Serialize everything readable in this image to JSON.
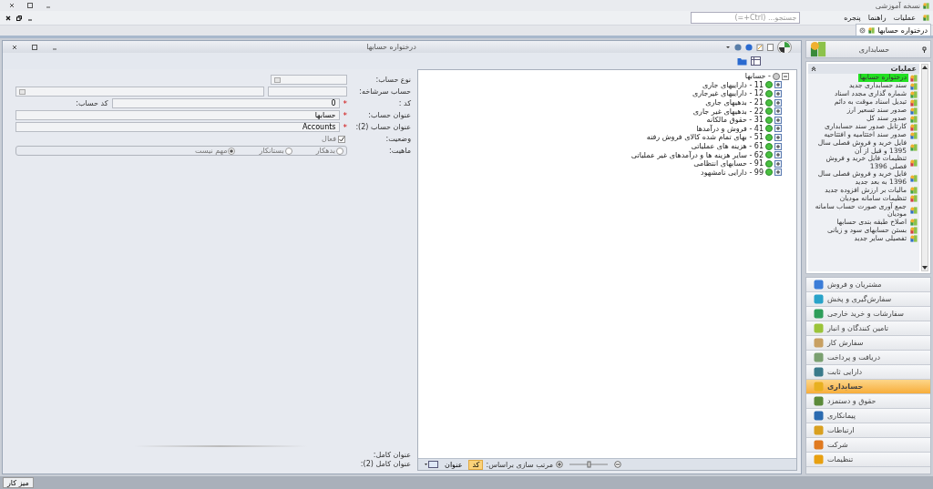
{
  "app": {
    "title": "نسخه آموزشی"
  },
  "menu": [
    "عملیات",
    "راهنما",
    "پنجره"
  ],
  "search": {
    "placeholder": "جستجو... (Ctrl+=)"
  },
  "doc_tabs": [
    {
      "label": "درختواره حسابها",
      "selected": true
    }
  ],
  "document": {
    "title": "درختواره حسابها",
    "form": {
      "fields": [
        {
          "kind": "select",
          "label": "نوع حساب:"
        },
        {
          "kind": "double",
          "label": "حساب سرشاخه:"
        },
        {
          "kind": "code",
          "label": "کد :",
          "required_mark": "*",
          "value": "0",
          "side_label": "کد حساب:"
        },
        {
          "kind": "text",
          "label": "عنوان حساب:",
          "required_mark": "*",
          "value": "حسابها"
        },
        {
          "kind": "text",
          "label": "عنوان حساب (2):",
          "required_mark": "*",
          "value": "Accounts"
        },
        {
          "kind": "check",
          "label": "وضعیت:",
          "option": "فعال",
          "checked": true
        },
        {
          "kind": "radio",
          "label": "ماهیت:",
          "options": [
            {
              "label": "بدهکار",
              "selected": false
            },
            {
              "label": "بستانکار",
              "selected": false
            },
            {
              "label": "مهم نیست",
              "selected": true
            }
          ]
        }
      ],
      "footer": [
        "عنوان کامل:",
        "عنوان کامل (2):"
      ]
    },
    "tree": {
      "root": {
        "label": "- حسابها",
        "expanded": true,
        "children": [
          {
            "label": "11 - داراییهای جاری",
            "expanded": false
          },
          {
            "label": "12 - داراییهای غیرجاری",
            "expanded": false
          },
          {
            "label": "21 - بدهیهای جاری",
            "expanded": false
          },
          {
            "label": "22 - بدهیهای غیر جاری",
            "expanded": false
          },
          {
            "label": "31 - حقوق مالکانه",
            "expanded": false
          },
          {
            "label": "41 - فروش و درآمدها",
            "expanded": false
          },
          {
            "label": "51 - بهای تمام شده کالای فروش رفته",
            "expanded": false
          },
          {
            "label": "61 - هزینه های عملیاتی",
            "expanded": false
          },
          {
            "label": "62 - سایر هزینه ها و درآمدهای غیر عملیاتی",
            "expanded": false
          },
          {
            "label": "91 - حسابهای انتظامی",
            "expanded": false
          },
          {
            "label": "99 - دارایی نامشهود",
            "expanded": false
          }
        ]
      }
    },
    "status": {
      "sort_label": "مرتب سازی براساس:",
      "sort_options": [
        {
          "label": "کد",
          "selected": true
        },
        {
          "label": "عنوان",
          "selected": false
        }
      ]
    }
  },
  "sidebar": {
    "title": "حسابداری",
    "section": "عملیات",
    "items": [
      {
        "label": "درختواره حسابها",
        "selected": true
      },
      {
        "label": "سند حسابداری جدید",
        "selected": false
      },
      {
        "label": "شماره گذاری مجدد اسناد",
        "selected": false
      },
      {
        "label": "تبدیل اسناد موقت به دائم",
        "selected": false
      },
      {
        "label": "صدور سند تسعیر ارز",
        "selected": false
      },
      {
        "label": "صدور سند کل",
        "selected": false
      },
      {
        "label": "کارتابل صدور سند حسابداری",
        "selected": false
      },
      {
        "label": "صدور سند اختتامیه و افتتاحیه",
        "selected": false
      },
      {
        "label": "فایل خرید و فروش فصلی سال 1395 و قبل از آن",
        "selected": false
      },
      {
        "label": "تنظیمات فایل خرید و فروش فصلی 1396",
        "selected": false
      },
      {
        "label": "فایل خرید و فروش فصلی سال 1396 به بعد جدید",
        "selected": false
      },
      {
        "label": "مالیات بر ارزش افزوده جدید",
        "selected": false
      },
      {
        "label": "تنظیمات سامانه مودیان",
        "selected": false
      },
      {
        "label": "جمع آوری صورت حساب سامانه مودیان",
        "selected": false
      },
      {
        "label": "اصلاح طبقه بندی حسابها",
        "selected": false
      },
      {
        "label": "بستن حسابهای سود و زیانی",
        "selected": false
      },
      {
        "label": "تفصیلی سایر جدید",
        "selected": false
      }
    ],
    "modules": [
      {
        "label": "مشتریان و فروش",
        "selected": false,
        "color": "#3b7dd8"
      },
      {
        "label": "سفارش‌گیری و پخش",
        "selected": false,
        "color": "#29a3c9"
      },
      {
        "label": "سفارشات و خرید خارجی",
        "selected": false,
        "color": "#2e9e5a"
      },
      {
        "label": "تامین کنندگان و انبار",
        "selected": false,
        "color": "#9bc43a"
      },
      {
        "label": "سفارش کار",
        "selected": false,
        "color": "#c8a062"
      },
      {
        "label": "دریافت و پرداخت",
        "selected": false,
        "color": "#7aa070"
      },
      {
        "label": "دارایی ثابت",
        "selected": false,
        "color": "#3a7a8a"
      },
      {
        "label": "حسابداری",
        "selected": true,
        "color": "#e8b020"
      },
      {
        "label": "حقوق و دستمزد",
        "selected": false,
        "color": "#5c8a3a"
      },
      {
        "label": "پیمانکاری",
        "selected": false,
        "color": "#2a6ab0"
      },
      {
        "label": "ارتباطات",
        "selected": false,
        "color": "#d9a020"
      },
      {
        "label": "شرکت",
        "selected": false,
        "color": "#e07a20"
      },
      {
        "label": "تنظیمات",
        "selected": false,
        "color": "#e8a010"
      }
    ]
  },
  "taskbar": {
    "button": "میز کار"
  }
}
